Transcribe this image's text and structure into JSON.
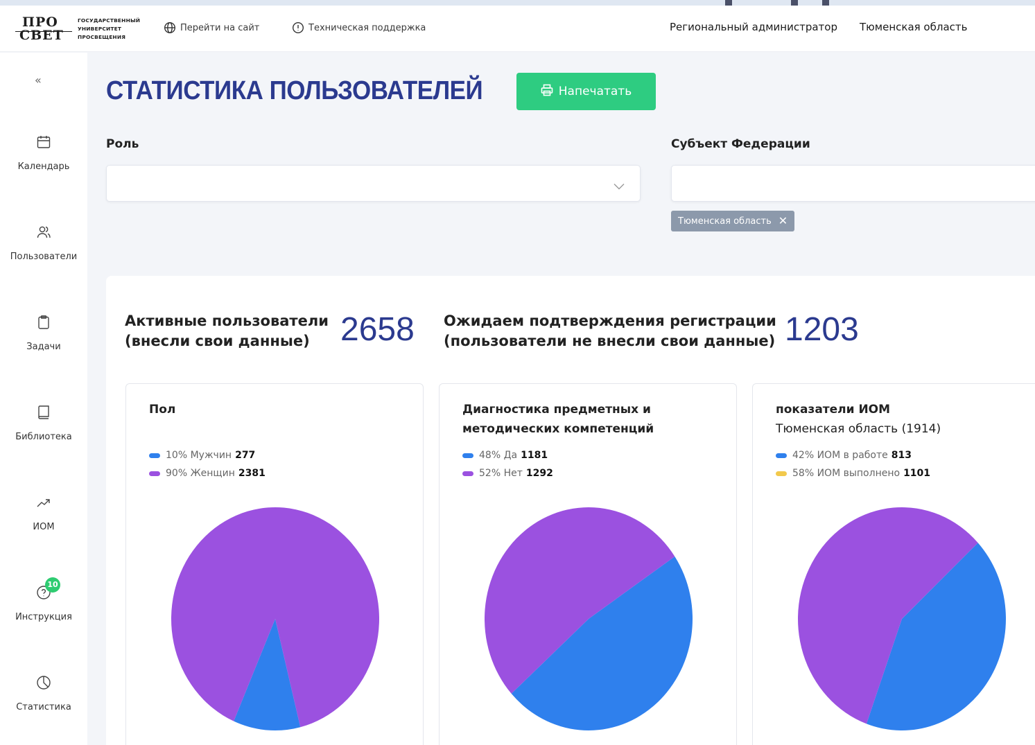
{
  "header": {
    "logo": {
      "mark_line1": "ПРО",
      "mark_line2": "СВЕТ",
      "text_lines": [
        "ГОСУДАРСТВЕННЫЙ",
        "УНИВЕРСИТЕТ",
        "ПРОСВЕЩЕНИЯ"
      ]
    },
    "link_site": "Перейти на сайт",
    "link_support": "Техническая поддержка",
    "role": "Региональный администратор",
    "region": "Тюменская область"
  },
  "sidebar": {
    "collapse": "«",
    "items": [
      {
        "label": "Календарь",
        "icon": "calendar-icon"
      },
      {
        "label": "Пользователи",
        "icon": "users-icon"
      },
      {
        "label": "Задачи",
        "icon": "clipboard-icon"
      },
      {
        "label": "Библиотека",
        "icon": "book-icon"
      },
      {
        "label": "ИОМ",
        "icon": "trending-up-icon"
      },
      {
        "label": "Инструкция",
        "icon": "help-circle-icon",
        "badge": "10"
      },
      {
        "label": "Статистика",
        "icon": "pie-chart-icon"
      }
    ]
  },
  "main": {
    "title": "СТАТИСТИКА ПОЛЬЗОВАТЕЛЕЙ",
    "print_button": "Напечатать",
    "filters": {
      "role_label": "Роль",
      "role_value": "",
      "subject_label": "Субъект Федерации",
      "subject_value": "",
      "subject_tag": "Тюменская область"
    },
    "stats": {
      "active_label_1": "Активные пользователи",
      "active_label_2": "(внесли свои данные)",
      "active_value": "2658",
      "pending_label_1": "Ожидаем подтверждения регистрации",
      "pending_label_2": "(пользователи не внесли свои данные)",
      "pending_value": "1203"
    }
  },
  "colors": {
    "blue": "#2f80ed",
    "purple": "#9b51e0",
    "yellow": "#f2c94c",
    "green": "#2ecc81",
    "title": "#2b3a8f"
  },
  "chart_data": [
    {
      "type": "pie",
      "title": "Пол",
      "subtitle": "",
      "slices": [
        {
          "percent_label": "10%",
          "label": "Мужчин",
          "value": 277,
          "color": "#2f80ed"
        },
        {
          "percent_label": "90%",
          "label": "Женщин",
          "value": 2381,
          "color": "#9b51e0"
        }
      ]
    },
    {
      "type": "pie",
      "title": "Диагностика предметных и методических компетенций",
      "subtitle": "",
      "slices": [
        {
          "percent_label": "48%",
          "label": "Да",
          "value": 1181,
          "color": "#2f80ed"
        },
        {
          "percent_label": "52%",
          "label": "Нет",
          "value": 1292,
          "color": "#9b51e0"
        }
      ]
    },
    {
      "type": "pie",
      "title": "показатели ИОМ",
      "subtitle": "Тюменская область (1914)",
      "slices": [
        {
          "percent_label": "42%",
          "label": "ИОМ в работе",
          "value": 813,
          "color": "#2f80ed",
          "legend_color": "#2f80ed"
        },
        {
          "percent_label": "58%",
          "label": "ИОМ выполнено",
          "value": 1101,
          "color": "#9b51e0",
          "legend_color": "#f2c94c"
        }
      ]
    }
  ]
}
